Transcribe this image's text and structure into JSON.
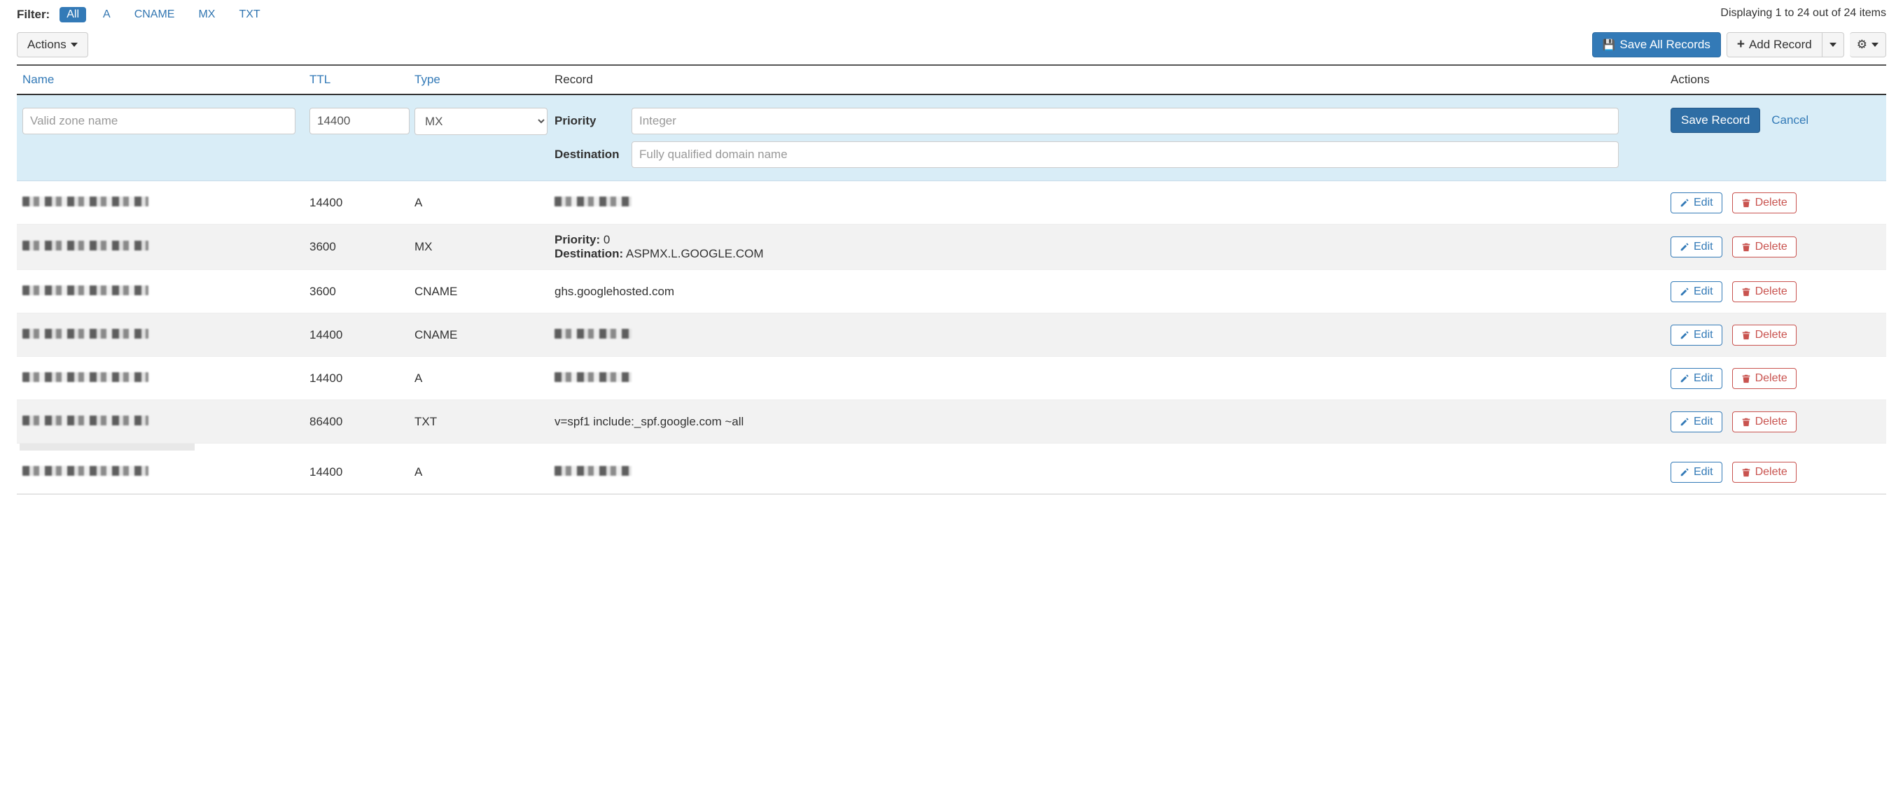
{
  "filter": {
    "label": "Filter:",
    "options": [
      "All",
      "A",
      "CNAME",
      "MX",
      "TXT"
    ],
    "active": "All"
  },
  "display_text": "Displaying 1 to 24 out of 24 items",
  "toolbar": {
    "actions_label": "Actions",
    "save_all_label": "Save All Records",
    "add_record_label": "Add Record"
  },
  "columns": {
    "name": "Name",
    "ttl": "TTL",
    "type": "Type",
    "record": "Record",
    "actions": "Actions"
  },
  "edit_row": {
    "name_placeholder": "Valid zone name",
    "ttl_value": "14400",
    "type_value": "MX",
    "priority_label": "Priority",
    "priority_placeholder": "Integer",
    "destination_label": "Destination",
    "destination_placeholder": "Fully qualified domain name",
    "save_label": "Save Record",
    "cancel_label": "Cancel"
  },
  "action_buttons": {
    "edit": "Edit",
    "delete": "Delete"
  },
  "rows": [
    {
      "name_obscured": true,
      "ttl": "14400",
      "type": "A",
      "record_obscured": true
    },
    {
      "name_obscured": true,
      "ttl": "3600",
      "type": "MX",
      "record_obscured": false,
      "priority_label": "Priority:",
      "priority_value": "0",
      "destination_label": "Destination:",
      "destination_value": "ASPMX.L.GOOGLE.COM"
    },
    {
      "name_obscured": true,
      "ttl": "3600",
      "type": "CNAME",
      "record_obscured": false,
      "record_value": "ghs.googlehosted.com"
    },
    {
      "name_obscured": true,
      "ttl": "14400",
      "type": "CNAME",
      "record_obscured": true
    },
    {
      "name_obscured": true,
      "ttl": "14400",
      "type": "A",
      "record_obscured": true
    },
    {
      "name_obscured": true,
      "ttl": "86400",
      "type": "TXT",
      "record_obscured": false,
      "record_value": "v=spf1 include:_spf.google.com ~all"
    },
    {
      "name_obscured": true,
      "ttl": "14400",
      "type": "A",
      "record_obscured": true
    }
  ]
}
